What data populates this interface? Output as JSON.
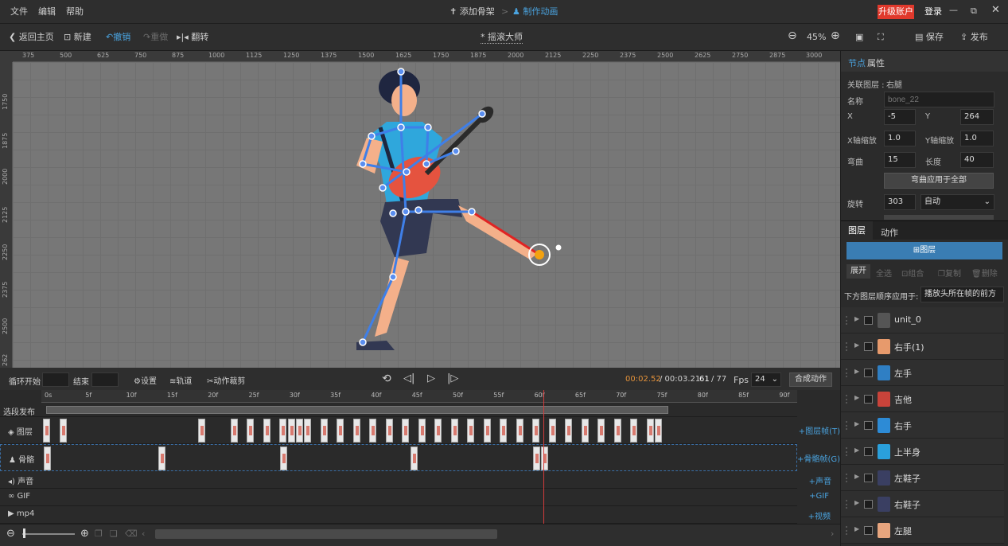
{
  "menu": {
    "file": "文件",
    "edit": "编辑",
    "help": "帮助"
  },
  "steps": {
    "add_bone": "添加骨架",
    "separator": ">",
    "make_anim": "制作动画"
  },
  "account": {
    "upgrade": "升级账户",
    "login": "登录"
  },
  "toolbar": {
    "back": "返回主页",
    "new": "新建",
    "undo": "撤销",
    "redo": "重做",
    "flip": "翻转",
    "project_title": "* 摇滚大师",
    "zoom": "45%",
    "save": "保存",
    "publish": "发布"
  },
  "ruler": {
    "top": [
      "375",
      "500",
      "625",
      "750",
      "875",
      "1000",
      "1125",
      "1250",
      "1375",
      "1500",
      "1625",
      "1750",
      "1875",
      "2000",
      "2125",
      "2250",
      "2375",
      "2500",
      "2625",
      "2750",
      "2875",
      "3000"
    ],
    "left": [
      "1750",
      "1875",
      "2000",
      "2125",
      "2250",
      "2375",
      "2500",
      "262"
    ]
  },
  "props": {
    "tab_node": "节点",
    "tab_attr": "属性",
    "linked_layer_label": "关联图层 :",
    "linked_layer_value": "右腿",
    "name_label": "名称",
    "name_placeholder": "bone_22",
    "x_label": "X",
    "x_value": "-5",
    "y_label": "Y",
    "y_value": "264",
    "xscale_label": "X轴缩放",
    "xscale_value": "1.0",
    "yscale_label": "Y轴缩放",
    "yscale_value": "1.0",
    "bend_label": "弯曲",
    "bend_value": "15",
    "length_label": "长度",
    "length_value": "40",
    "apply_bend": "弯曲应用于全部",
    "rotate_label": "旋转",
    "rotate_value": "303",
    "rotate_mode": "自动"
  },
  "layers_panel": {
    "tab_layers": "图层",
    "tab_actions": "动作",
    "add_layer": "图层",
    "expand": "展开",
    "select_all": "全选",
    "group": "组合",
    "copy": "复制",
    "delete": "删除",
    "order_label": "下方图层顺序应用于:",
    "order_value": "播放头所在帧的前方",
    "items": [
      "unit_0",
      "右手(1)",
      "左手",
      "吉他",
      "右手",
      "上半身",
      "左鞋子",
      "右鞋子",
      "左腿"
    ]
  },
  "timeline": {
    "loop_start": "循环开始",
    "end": "结束",
    "settings": "设置",
    "track": "轨道",
    "crop": "动作裁剪",
    "current_time": "00:02.52",
    "total_time": "/ 00:03.21",
    "frame": "61",
    "total_frames": "/ 77",
    "fps_label": "Fps",
    "fps_value": "24",
    "compose": "合成动作",
    "ticks": [
      "0s",
      "5f",
      "10f",
      "15f",
      "20f",
      "25f",
      "30f",
      "35f",
      "40f",
      "45f",
      "50f",
      "55f",
      "60f",
      "65f",
      "70f",
      "75f",
      "80f",
      "85f",
      "90f"
    ],
    "tracks": {
      "segment": "选段发布",
      "layers": "图层",
      "bones": "骨骼",
      "sound": "声音",
      "gif": "GIF",
      "mp4": "mp4"
    },
    "add": {
      "layer_frame": "+图层帧(T)",
      "bone_frame": "+骨骼帧(G)",
      "sound": "+声音",
      "gif": "+GIF",
      "video": "+视频"
    },
    "playhead_frame": 61,
    "layer_keyframes": [
      0,
      2,
      19,
      23,
      25,
      27,
      29,
      30,
      31,
      32,
      34,
      36,
      38,
      40,
      42,
      44,
      46,
      48,
      50,
      52,
      54,
      56,
      58,
      60,
      62,
      64,
      66,
      68,
      70,
      72,
      74,
      75
    ],
    "bone_keyframes": [
      0,
      14,
      29,
      45,
      60,
      61
    ]
  },
  "colors": {
    "accent": "#4aa3df",
    "upgrade": "#e0392c",
    "playhead": "#d23b3b",
    "time": "#e2913a"
  }
}
